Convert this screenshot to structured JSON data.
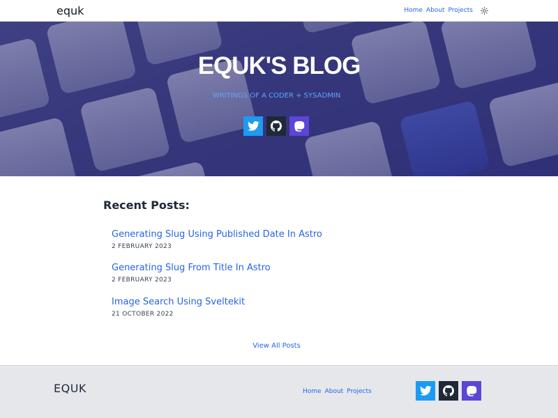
{
  "nav": {
    "brand": "equk",
    "links": [
      "Home",
      "About",
      "Projects"
    ],
    "theme_icon": "sun-icon"
  },
  "hero": {
    "title": "EQUK'S BLOG",
    "subtitle": "WRITINGS OF A CODER + SYSADMIN",
    "social": [
      {
        "name": "twitter",
        "icon": "twitter-icon",
        "color": "#1d9bf0"
      },
      {
        "name": "github",
        "icon": "github-icon",
        "color": "#1f2937"
      },
      {
        "name": "mastodon",
        "icon": "mastodon-icon",
        "color": "#5b46d6"
      }
    ]
  },
  "main": {
    "heading": "Recent Posts:",
    "posts": [
      {
        "title": "Generating Slug Using Published Date In Astro",
        "date": "2 FEBRUARY 2023"
      },
      {
        "title": "Generating Slug From Title In Astro",
        "date": "2 FEBRUARY 2023"
      },
      {
        "title": "Image Search Using Sveltekit",
        "date": "21 OCTOBER 2022"
      }
    ],
    "view_all": "View All Posts"
  },
  "footer": {
    "brand": "EQUK",
    "links": [
      "Home",
      "About",
      "Projects"
    ]
  },
  "colors": {
    "link": "#2563eb",
    "hero_overlay": "#312e81",
    "footer_bg": "#e5e7eb"
  }
}
